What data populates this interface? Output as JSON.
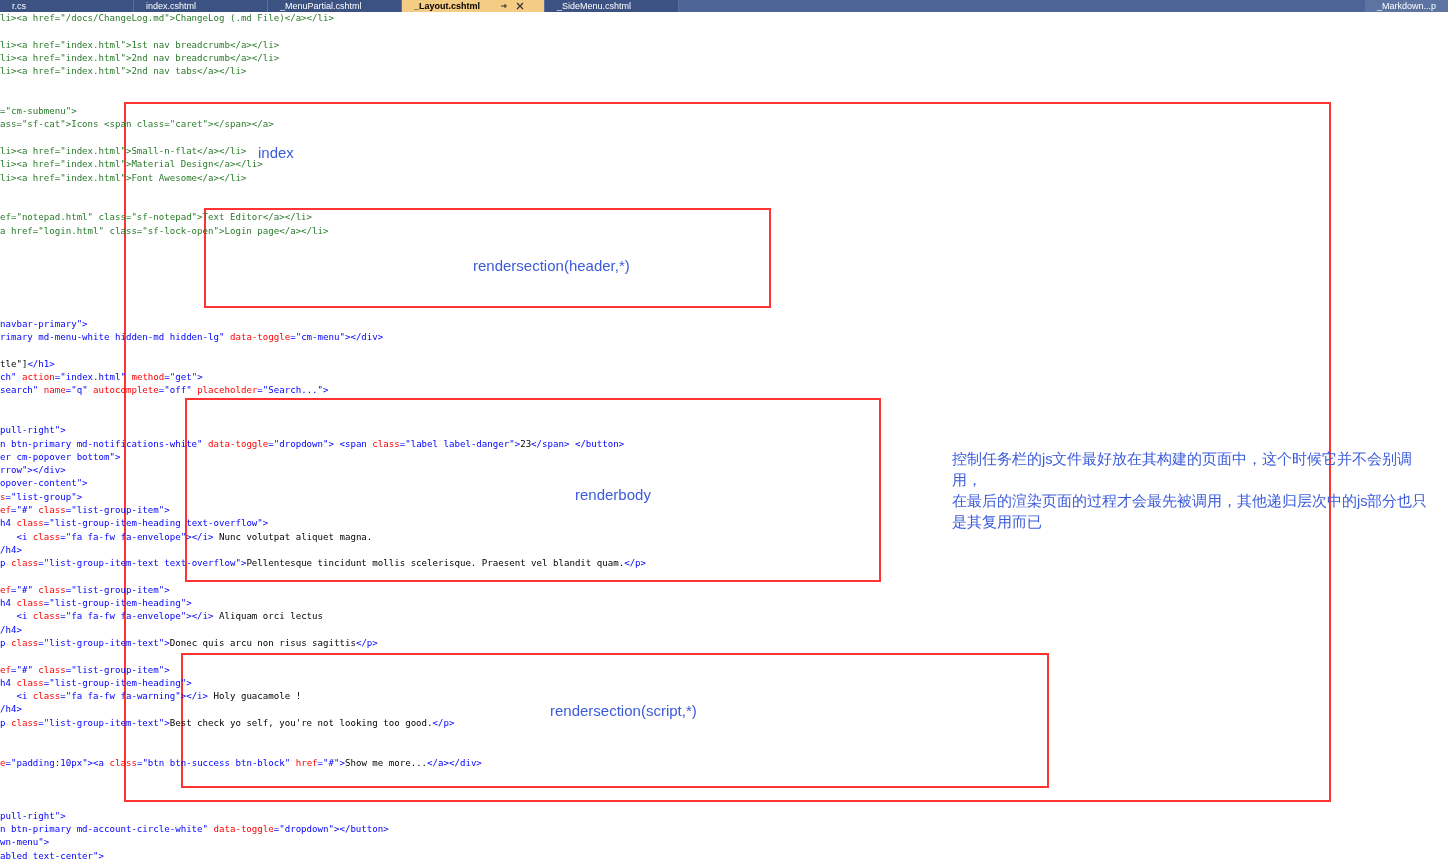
{
  "tabs": [
    {
      "label": "r.cs",
      "selected": false
    },
    {
      "label": "index.cshtml",
      "selected": false
    },
    {
      "label": "_MenuPartial.cshtml",
      "selected": false
    },
    {
      "label": "_Layout.cshtml",
      "selected": true
    },
    {
      "label": "_SideMenu.cshtml",
      "selected": false
    }
  ],
  "overflow_tab": {
    "label": "_Markdown...p"
  },
  "code_lines": [
    {
      "kind": "code",
      "tokens": [
        {
          "kind": "comment",
          "text": "li><a href=\"/docs/ChangeLog.md\">ChangeLog (.md File)</a></li>"
        }
      ]
    },
    {
      "kind": "blank"
    },
    {
      "kind": "code",
      "tokens": [
        {
          "kind": "comment",
          "text": "li><a href=\"index.html\">1st nav breadcrumb</a></li>"
        }
      ]
    },
    {
      "kind": "code",
      "tokens": [
        {
          "kind": "comment",
          "text": "li><a href=\"index.html\">2nd nav breadcrumb</a></li>"
        }
      ]
    },
    {
      "kind": "code",
      "tokens": [
        {
          "kind": "comment",
          "text": "li><a href=\"index.html\">2nd nav tabs</a></li>"
        }
      ]
    },
    {
      "kind": "blank"
    },
    {
      "kind": "blank"
    },
    {
      "kind": "code",
      "tokens": [
        {
          "kind": "comment",
          "text": "=\"cm-submenu\">"
        }
      ]
    },
    {
      "kind": "code",
      "tokens": [
        {
          "kind": "comment",
          "text": "ass=\"sf-cat\">Icons <span class=\"caret\"></span></a>"
        }
      ]
    },
    {
      "kind": "blank"
    },
    {
      "kind": "code",
      "tokens": [
        {
          "kind": "comment",
          "text": "li><a href=\"index.html\">Small-n-flat</a></li>"
        }
      ]
    },
    {
      "kind": "code",
      "tokens": [
        {
          "kind": "comment",
          "text": "li><a href=\"index.html\">Material Design</a></li>"
        }
      ]
    },
    {
      "kind": "code",
      "tokens": [
        {
          "kind": "comment",
          "text": "li><a href=\"index.html\">Font Awesome</a></li>"
        }
      ]
    },
    {
      "kind": "blank"
    },
    {
      "kind": "blank"
    },
    {
      "kind": "code",
      "tokens": [
        {
          "kind": "comment",
          "text": "ef=\"notepad.html\" class=\"sf-notepad\">Text Editor</a></li>"
        }
      ]
    },
    {
      "kind": "code",
      "tokens": [
        {
          "kind": "comment",
          "text": "a href=\"login.html\" class=\"sf-lock-open\">Login page</a></li>"
        }
      ]
    },
    {
      "kind": "blank"
    },
    {
      "kind": "blank"
    },
    {
      "kind": "blank"
    },
    {
      "kind": "blank"
    },
    {
      "kind": "blank"
    },
    {
      "kind": "blank"
    },
    {
      "kind": "code",
      "tokens": [
        {
          "kind": "markup",
          "text": "navbar-primary\">"
        }
      ]
    },
    {
      "kind": "code",
      "tokens": [
        {
          "kind": "markup",
          "text": "rimary md-menu-white hidden-md hidden-lg\""
        },
        {
          "kind": "attr",
          "text": " data-toggle"
        },
        {
          "kind": "markup",
          "text": "=\"cm-menu\"></div>"
        }
      ]
    },
    {
      "kind": "blank"
    },
    {
      "kind": "code",
      "tokens": [
        {
          "kind": "text",
          "text": "tle\"]"
        },
        {
          "kind": "markup",
          "text": "</h1>"
        }
      ]
    },
    {
      "kind": "code",
      "tokens": [
        {
          "kind": "markup",
          "text": "ch\""
        },
        {
          "kind": "attr",
          "text": " action"
        },
        {
          "kind": "markup",
          "text": "=\"index.html\""
        },
        {
          "kind": "attr",
          "text": " method"
        },
        {
          "kind": "markup",
          "text": "=\"get\">"
        }
      ]
    },
    {
      "kind": "code",
      "tokens": [
        {
          "kind": "markup",
          "text": "search\""
        },
        {
          "kind": "attr",
          "text": " name"
        },
        {
          "kind": "markup",
          "text": "=\"q\""
        },
        {
          "kind": "attr",
          "text": " autocomplete"
        },
        {
          "kind": "markup",
          "text": "=\"off\""
        },
        {
          "kind": "attr",
          "text": " placeholder"
        },
        {
          "kind": "markup",
          "text": "=\"Search...\">"
        }
      ]
    },
    {
      "kind": "blank"
    },
    {
      "kind": "blank"
    },
    {
      "kind": "code",
      "tokens": [
        {
          "kind": "markup",
          "text": "pull-right\">"
        }
      ]
    },
    {
      "kind": "code",
      "tokens": [
        {
          "kind": "markup",
          "text": "n btn-primary md-notifications-white\""
        },
        {
          "kind": "attr",
          "text": " data-toggle"
        },
        {
          "kind": "markup",
          "text": "=\"dropdown\"> <span"
        },
        {
          "kind": "attr",
          "text": " class"
        },
        {
          "kind": "markup",
          "text": "=\"label label-danger\">"
        },
        {
          "kind": "text",
          "text": "23"
        },
        {
          "kind": "markup",
          "text": "</span> </button>"
        }
      ]
    },
    {
      "kind": "code",
      "tokens": [
        {
          "kind": "markup",
          "text": "er cm-popover bottom\">"
        }
      ]
    },
    {
      "kind": "code",
      "tokens": [
        {
          "kind": "markup",
          "text": "rrow\"></div>"
        }
      ]
    },
    {
      "kind": "code",
      "tokens": [
        {
          "kind": "markup",
          "text": "opover-content\">"
        }
      ]
    },
    {
      "kind": "code",
      "tokens": [
        {
          "kind": "attr",
          "text": "s"
        },
        {
          "kind": "markup",
          "text": "=\"list-group\">"
        }
      ]
    },
    {
      "kind": "code",
      "tokens": [
        {
          "kind": "attr",
          "text": "ef"
        },
        {
          "kind": "markup",
          "text": "=\"#\""
        },
        {
          "kind": "attr",
          "text": " class"
        },
        {
          "kind": "markup",
          "text": "=\"list-group-item\">"
        }
      ]
    },
    {
      "kind": "code",
      "tokens": [
        {
          "kind": "markup",
          "text": "h4"
        },
        {
          "kind": "attr",
          "text": " class"
        },
        {
          "kind": "markup",
          "text": "=\"list-group-item-heading text-overflow\">"
        }
      ]
    },
    {
      "kind": "code",
      "tokens": [
        {
          "kind": "markup",
          "text": "   <i"
        },
        {
          "kind": "attr",
          "text": " class"
        },
        {
          "kind": "markup",
          "text": "=\"fa fa-fw fa-envelope\"></i>"
        },
        {
          "kind": "text",
          "text": " Nunc volutpat aliquet magna."
        }
      ]
    },
    {
      "kind": "code",
      "tokens": [
        {
          "kind": "markup",
          "text": "/h4>"
        }
      ]
    },
    {
      "kind": "code",
      "tokens": [
        {
          "kind": "markup",
          "text": "p"
        },
        {
          "kind": "attr",
          "text": " class"
        },
        {
          "kind": "markup",
          "text": "=\"list-group-item-text text-overflow\">"
        },
        {
          "kind": "text",
          "text": "Pellentesque tincidunt mollis scelerisque. Praesent vel blandit quam."
        },
        {
          "kind": "markup",
          "text": "</p>"
        }
      ]
    },
    {
      "kind": "blank"
    },
    {
      "kind": "code",
      "tokens": [
        {
          "kind": "attr",
          "text": "ef"
        },
        {
          "kind": "markup",
          "text": "=\"#\""
        },
        {
          "kind": "attr",
          "text": " class"
        },
        {
          "kind": "markup",
          "text": "=\"list-group-item\">"
        }
      ]
    },
    {
      "kind": "code",
      "tokens": [
        {
          "kind": "markup",
          "text": "h4"
        },
        {
          "kind": "attr",
          "text": " class"
        },
        {
          "kind": "markup",
          "text": "=\"list-group-item-heading\">"
        }
      ]
    },
    {
      "kind": "code",
      "tokens": [
        {
          "kind": "markup",
          "text": "   <i"
        },
        {
          "kind": "attr",
          "text": " class"
        },
        {
          "kind": "markup",
          "text": "=\"fa fa-fw fa-envelope\"></i>"
        },
        {
          "kind": "text",
          "text": " Aliquam orci lectus"
        }
      ]
    },
    {
      "kind": "code",
      "tokens": [
        {
          "kind": "markup",
          "text": "/h4>"
        }
      ]
    },
    {
      "kind": "code",
      "tokens": [
        {
          "kind": "markup",
          "text": "p"
        },
        {
          "kind": "attr",
          "text": " class"
        },
        {
          "kind": "markup",
          "text": "=\"list-group-item-text\">"
        },
        {
          "kind": "text",
          "text": "Donec quis arcu non risus sagittis"
        },
        {
          "kind": "markup",
          "text": "</p>"
        }
      ]
    },
    {
      "kind": "blank"
    },
    {
      "kind": "code",
      "tokens": [
        {
          "kind": "attr",
          "text": "ef"
        },
        {
          "kind": "markup",
          "text": "=\"#\""
        },
        {
          "kind": "attr",
          "text": " class"
        },
        {
          "kind": "markup",
          "text": "=\"list-group-item\">"
        }
      ]
    },
    {
      "kind": "code",
      "tokens": [
        {
          "kind": "markup",
          "text": "h4"
        },
        {
          "kind": "attr",
          "text": " class"
        },
        {
          "kind": "markup",
          "text": "=\"list-group-item-heading\">"
        }
      ]
    },
    {
      "kind": "code",
      "tokens": [
        {
          "kind": "markup",
          "text": "   <i"
        },
        {
          "kind": "attr",
          "text": " class"
        },
        {
          "kind": "markup",
          "text": "=\"fa fa-fw fa-warning\"></i>"
        },
        {
          "kind": "text",
          "text": " Holy guacamole !"
        }
      ]
    },
    {
      "kind": "code",
      "tokens": [
        {
          "kind": "markup",
          "text": "/h4>"
        }
      ]
    },
    {
      "kind": "code",
      "tokens": [
        {
          "kind": "markup",
          "text": "p"
        },
        {
          "kind": "attr",
          "text": " class"
        },
        {
          "kind": "markup",
          "text": "=\"list-group-item-text\">"
        },
        {
          "kind": "text",
          "text": "Best check yo self, you're not looking too good."
        },
        {
          "kind": "markup",
          "text": "</p>"
        }
      ]
    },
    {
      "kind": "blank"
    },
    {
      "kind": "blank"
    },
    {
      "kind": "code",
      "tokens": [
        {
          "kind": "attr",
          "text": "e"
        },
        {
          "kind": "markup",
          "text": "=\"padding:10px\"><a"
        },
        {
          "kind": "attr",
          "text": " class"
        },
        {
          "kind": "markup",
          "text": "=\"btn btn-success btn-block\""
        },
        {
          "kind": "attr",
          "text": " href"
        },
        {
          "kind": "markup",
          "text": "=\"#\">"
        },
        {
          "kind": "text",
          "text": "Show me more..."
        },
        {
          "kind": "markup",
          "text": "</a></div>"
        }
      ]
    },
    {
      "kind": "blank"
    },
    {
      "kind": "blank"
    },
    {
      "kind": "blank"
    },
    {
      "kind": "code",
      "tokens": [
        {
          "kind": "markup",
          "text": "pull-right\">"
        }
      ]
    },
    {
      "kind": "code",
      "tokens": [
        {
          "kind": "markup",
          "text": "n btn-primary md-account-circle-white\""
        },
        {
          "kind": "attr",
          "text": " data-toggle"
        },
        {
          "kind": "markup",
          "text": "=\"dropdown\"></button>"
        }
      ]
    },
    {
      "kind": "code",
      "tokens": [
        {
          "kind": "markup",
          "text": "wn-menu\">"
        }
      ]
    },
    {
      "kind": "code",
      "tokens": [
        {
          "kind": "markup",
          "text": "abled text-center\">"
        }
      ]
    }
  ],
  "annotations": [
    {
      "label": "index"
    },
    {
      "label": "rendersection(header,*)"
    },
    {
      "label": "renderbody"
    },
    {
      "label": "rendersection(script,*)"
    }
  ],
  "note": {
    "lines": [
      "控制任务栏的js文件最好放在其构建的页面中，这个时候它并不会别调用，",
      "在最后的渲染页面的过程才会最先被调用，其他递归层次中的js部分也只是其复用而已"
    ]
  }
}
